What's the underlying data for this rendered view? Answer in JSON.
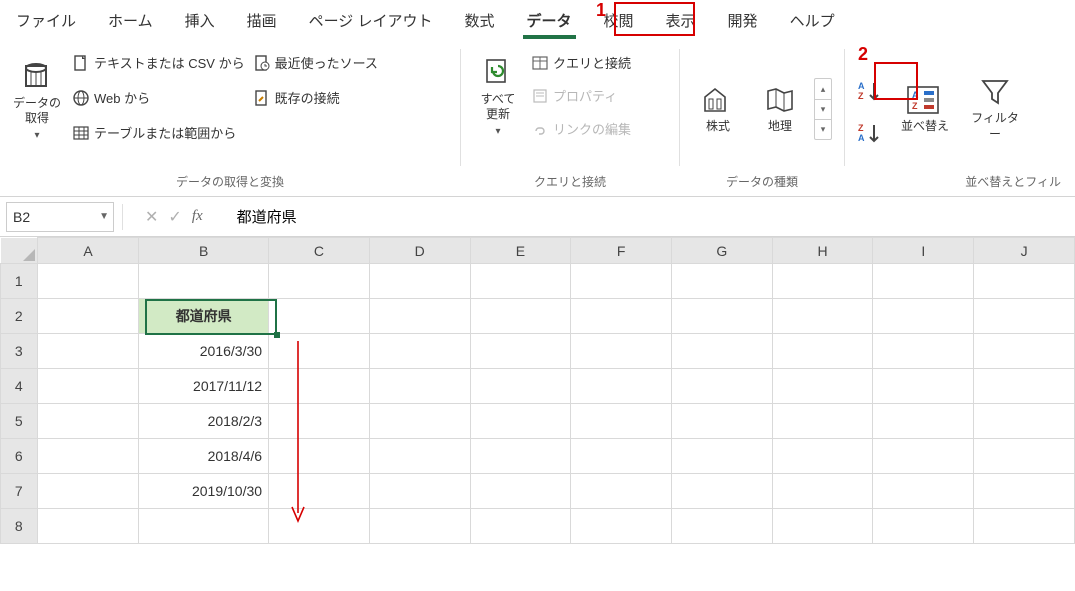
{
  "menu": {
    "file": "ファイル",
    "home": "ホーム",
    "insert": "挿入",
    "draw": "描画",
    "pagelayout": "ページ レイアウト",
    "formulas": "数式",
    "data": "データ",
    "review": "校閲",
    "view": "表示",
    "developer": "開発",
    "help": "ヘルプ"
  },
  "annotations": {
    "n1": "1",
    "n2": "2"
  },
  "ribbon": {
    "group1": {
      "label": "データの取得と変換",
      "getdata": "データの\n取得",
      "fromtext": "テキストまたは CSV から",
      "fromweb": "Web から",
      "fromtable": "テーブルまたは範囲から",
      "recent": "最近使ったソース",
      "existing": "既存の接続"
    },
    "group2": {
      "label": "クエリと接続",
      "refresh": "すべて\n更新",
      "queries": "クエリと接続",
      "properties": "プロパティ",
      "editlinks": "リンクの編集"
    },
    "group3": {
      "label": "データの種類",
      "stocks": "株式",
      "geography": "地理"
    },
    "group4": {
      "label": "並べ替えとフィル",
      "sort": "並べ替え",
      "filter": "フィルター"
    }
  },
  "formula_bar": {
    "namebox": "B2",
    "value": "都道府県"
  },
  "grid": {
    "columns": [
      "A",
      "B",
      "C",
      "D",
      "E",
      "F",
      "G",
      "H",
      "I",
      "J"
    ],
    "rows": [
      "1",
      "2",
      "3",
      "4",
      "5",
      "6",
      "7",
      "8"
    ],
    "b2": "都道府県",
    "b3": "2016/3/30",
    "b4": "2017/11/12",
    "b5": "2018/2/3",
    "b6": "2018/4/6",
    "b7": "2019/10/30"
  }
}
